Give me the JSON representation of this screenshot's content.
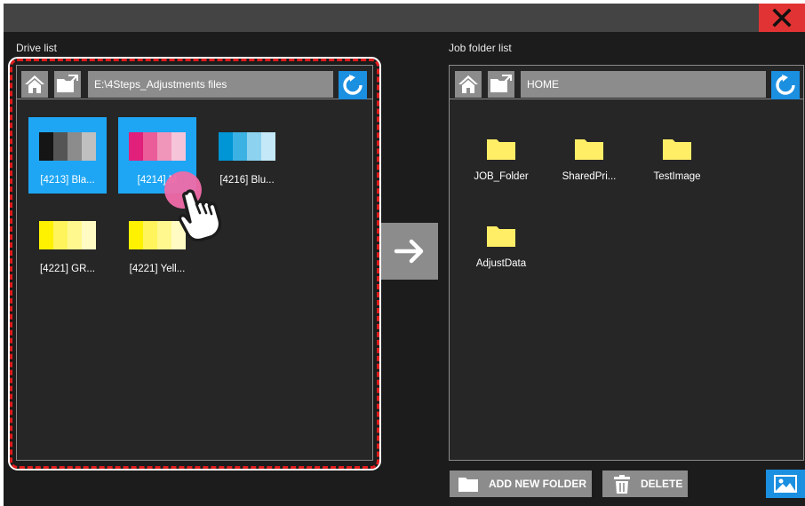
{
  "drive_list": {
    "label": "Drive list",
    "path": "E:\\4Steps_Adjustments files",
    "items": [
      {
        "label": "[4213] Bla...",
        "swatch": [
          "#151515",
          "#555555",
          "#8c8c8c",
          "#c0c0c0"
        ],
        "selected": true
      },
      {
        "label": "[4214] M",
        "swatch": [
          "#e0207a",
          "#eb5d99",
          "#f196bb",
          "#f6c4d8"
        ],
        "selected": true
      },
      {
        "label": "[4216] Blu...",
        "swatch": [
          "#0095d5",
          "#3cb2e4",
          "#8dd2ef",
          "#c4e8f7"
        ],
        "selected": false
      },
      {
        "label": "[4221] GR...",
        "swatch": [
          "#fff200",
          "#fff45c",
          "#fff88f",
          "#fffbc2"
        ],
        "selected": false
      },
      {
        "label": "[4221] Yell...",
        "swatch": [
          "#fff200",
          "#fff45c",
          "#fff88f",
          "#fffbc2"
        ],
        "selected": false
      }
    ]
  },
  "job_folder_list": {
    "label": "Job folder list",
    "path": "HOME",
    "folders": [
      "JOB_Folder",
      "SharedPri...",
      "TestImage",
      "AdjustData"
    ]
  },
  "buttons": {
    "add_new_folder": "ADD NEW FOLDER",
    "delete": "DELETE"
  },
  "colors": {
    "accent_blue": "#1b8fe0",
    "selected_tile": "#1ea6f4",
    "close_red": "#e13333",
    "highlight_dash": "#e21c1c",
    "folder_yellow": "#ffee66"
  }
}
